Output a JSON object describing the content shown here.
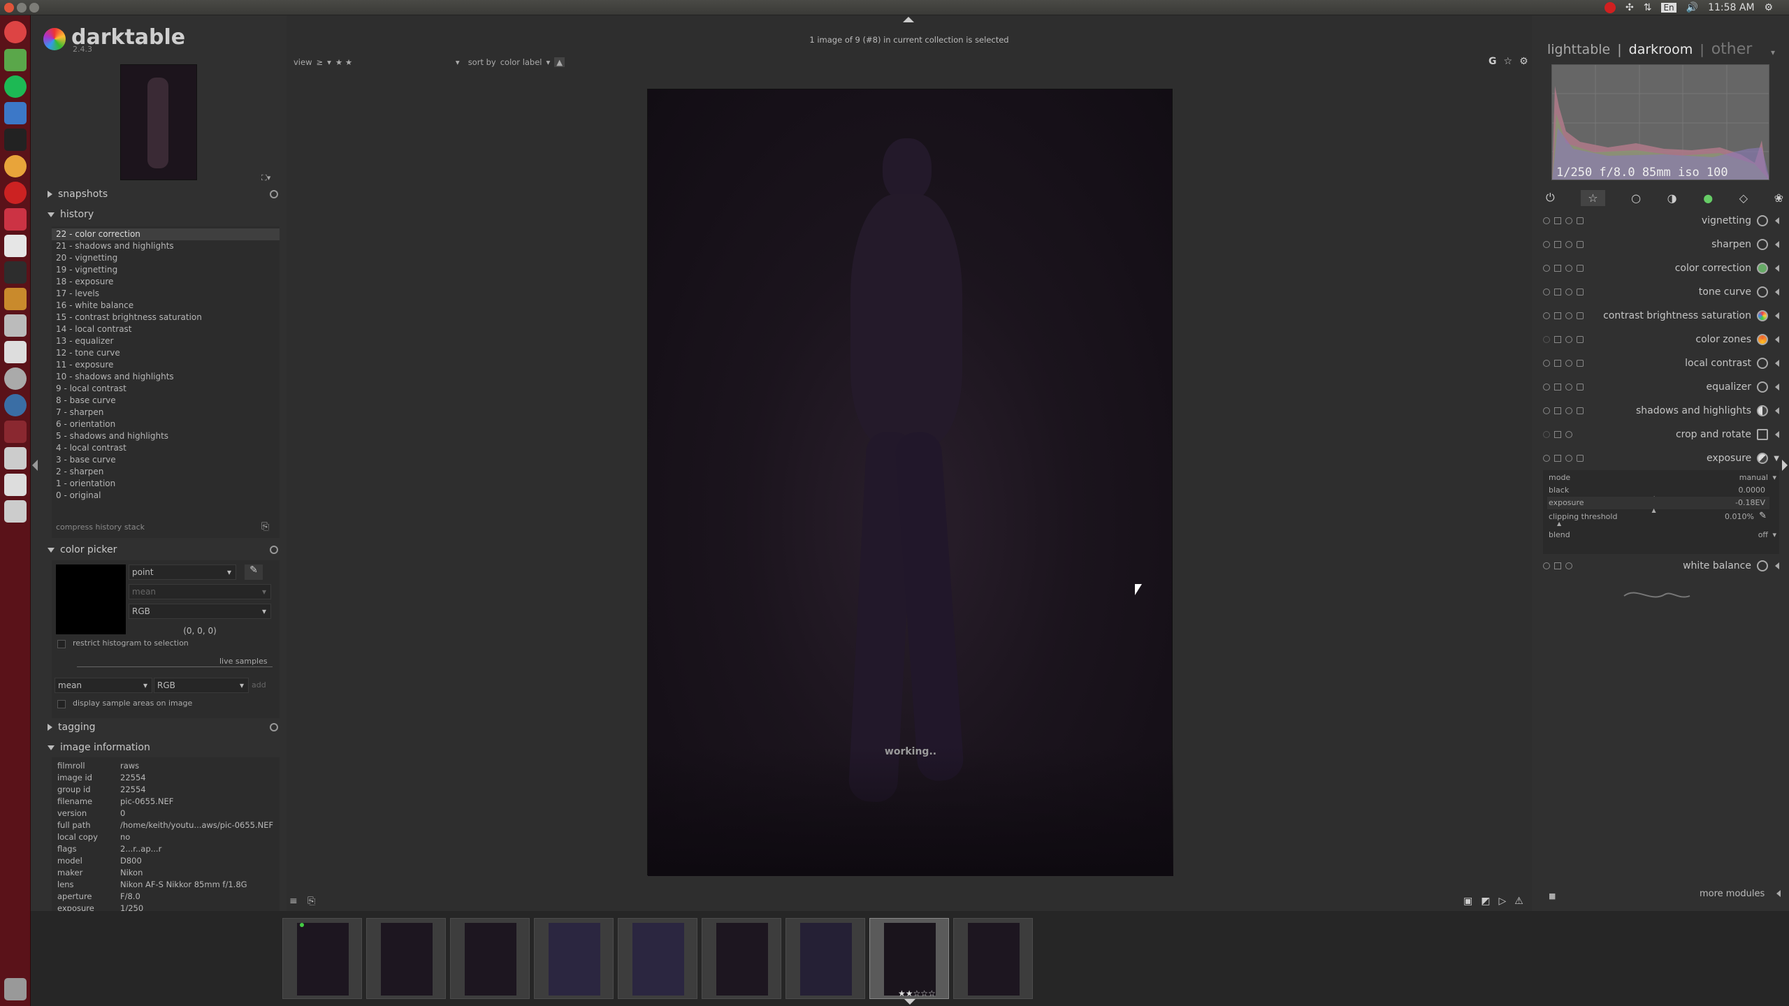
{
  "system": {
    "tray": {
      "lang": "En",
      "time": "11:58 AM"
    }
  },
  "app": {
    "name": "darktable",
    "version": "2.4.3"
  },
  "header": {
    "status": "1 image of 9 (#8) in current collection is selected",
    "views": {
      "lighttable": "lighttable",
      "sep1": "|",
      "darkroom": "darkroom",
      "sep2": "|",
      "other": "other"
    }
  },
  "toolbar": {
    "view_label": "view",
    "view_op": "≥",
    "view_stars": "★ ★",
    "sort_label": "sort by",
    "sort_value": "color label",
    "right_icons": {
      "g": "G",
      "star": "☆",
      "gear": "⚙"
    }
  },
  "left": {
    "snapshots": {
      "title": "snapshots"
    },
    "history": {
      "title": "history",
      "items": [
        "22 - color correction",
        "21 - shadows and highlights",
        "20 - vignetting",
        "19 - vignetting",
        "18 - exposure",
        "17 - levels",
        "16 - white balance",
        "15 - contrast brightness saturation",
        "14 - local contrast",
        "13 - equalizer",
        "12 - tone curve",
        "11 - exposure",
        "10 - shadows and highlights",
        "9 - local contrast",
        "8 - base curve",
        "7 - sharpen",
        "6 - orientation",
        "5 - shadows and highlights",
        "4 - local contrast",
        "3 - base curve",
        "2 - sharpen",
        "1 - orientation",
        "0 - original"
      ],
      "compress": "compress history stack"
    },
    "color_picker": {
      "title": "color picker",
      "mode": "point",
      "stat": "mean",
      "colorspace": "RGB",
      "value": "(0, 0, 0)",
      "restrict": "restrict histogram to selection",
      "live_samples": "live samples",
      "live_stat": "mean",
      "live_space": "RGB",
      "add": "add",
      "display_areas": "display sample areas on image"
    },
    "tagging": {
      "title": "tagging"
    },
    "image_information": {
      "title": "image information",
      "rows": [
        {
          "k": "filmroll",
          "v": "raws"
        },
        {
          "k": "image id",
          "v": "22554"
        },
        {
          "k": "group id",
          "v": "22554"
        },
        {
          "k": "filename",
          "v": "pic-0655.NEF"
        },
        {
          "k": "version",
          "v": "0"
        },
        {
          "k": "full path",
          "v": "/home/keith/youtu...aws/pic-0655.NEF"
        },
        {
          "k": "local copy",
          "v": "no"
        },
        {
          "k": "flags",
          "v": "2...r..ap...r"
        },
        {
          "k": "model",
          "v": "D800"
        },
        {
          "k": "maker",
          "v": "Nikon"
        },
        {
          "k": "lens",
          "v": "Nikon AF-S Nikkor 85mm f/1.8G"
        },
        {
          "k": "aperture",
          "v": "F/8.0"
        },
        {
          "k": "exposure",
          "v": "1/250"
        }
      ]
    }
  },
  "center": {
    "working": "working.."
  },
  "right": {
    "histogram_info": "1/250 f/8.0 85mm iso 100",
    "modules": [
      {
        "name": "vignetting",
        "symbol": "vignette-icon"
      },
      {
        "name": "sharpen",
        "symbol": "sharpen-icon"
      },
      {
        "name": "color correction",
        "symbol": "color-correction-icon"
      },
      {
        "name": "tone curve",
        "symbol": "tone-curve-icon"
      },
      {
        "name": "contrast brightness saturation",
        "symbol": "contrast-icon"
      },
      {
        "name": "color zones",
        "symbol": "color-zones-icon"
      },
      {
        "name": "local contrast",
        "symbol": "local-contrast-icon"
      },
      {
        "name": "equalizer",
        "symbol": "equalizer-icon"
      },
      {
        "name": "shadows and highlights",
        "symbol": "shadows-icon"
      },
      {
        "name": "crop and rotate",
        "symbol": "crop-icon"
      }
    ],
    "exposure": {
      "title": "exposure",
      "mode_label": "mode",
      "mode_value": "manual",
      "black_label": "black",
      "black_value": "0.0000",
      "black_level": 0.0,
      "exposure_label": "exposure",
      "exposure_value": "-0.18EV",
      "exposure_level": 0.47,
      "clip_label": "clipping threshold",
      "clip_value": "0.010%",
      "blend_label": "blend",
      "blend_value": "off"
    },
    "white_balance": {
      "name": "white balance"
    },
    "more_modules": "more modules"
  },
  "filmstrip": {
    "count": 9,
    "selected": 8
  }
}
